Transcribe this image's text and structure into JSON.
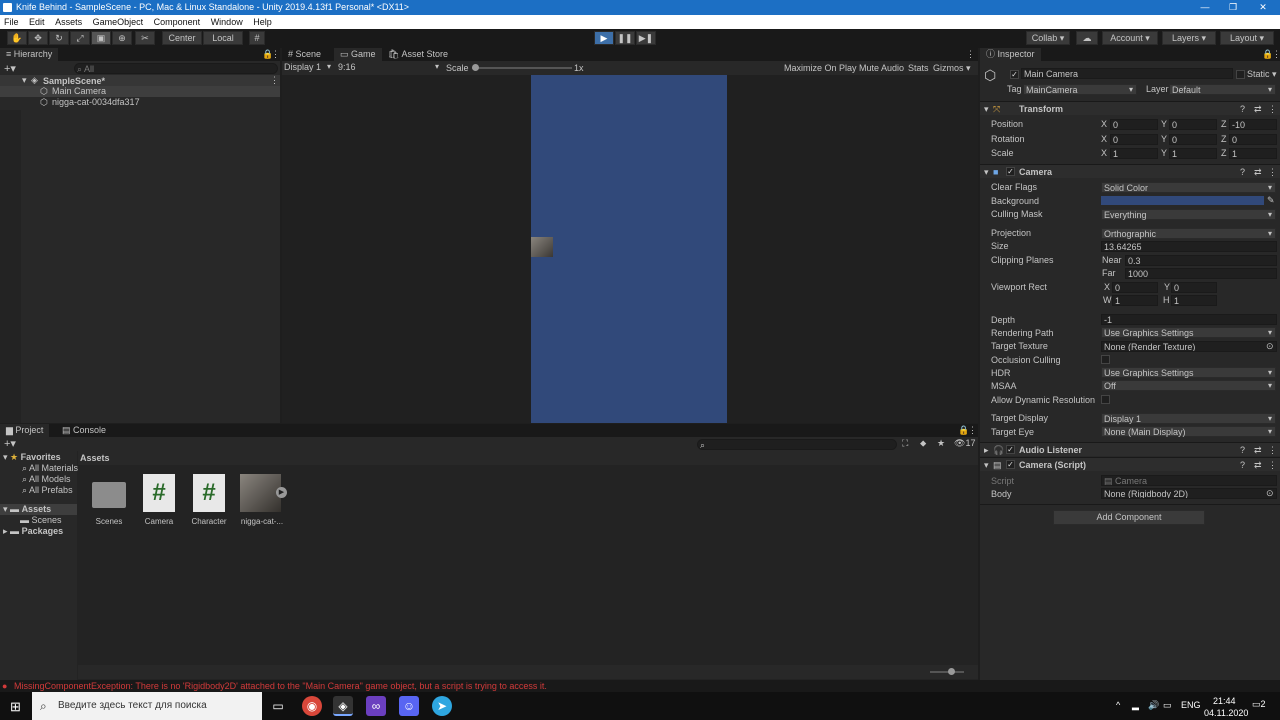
{
  "window": {
    "title": "Knife Behind - SampleScene - PC, Mac & Linux Standalone - Unity 2019.4.13f1 Personal* <DX11>"
  },
  "menu": [
    "File",
    "Edit",
    "Assets",
    "GameObject",
    "Component",
    "Window",
    "Help"
  ],
  "toolbar": {
    "center": "Center",
    "local": "Local",
    "collab": "Collab ▾",
    "account": "Account",
    "layers": "Layers",
    "layout": "Layout"
  },
  "hierarchy": {
    "tab": "Hierarchy",
    "search_placeholder": "All",
    "scene": "SampleScene*",
    "items": [
      "Main Camera",
      "nigga-cat-0034dfa317"
    ]
  },
  "scene_tabs": [
    "Scene",
    "Game",
    "Asset Store"
  ],
  "game": {
    "display": "Display 1",
    "aspect": "9:16",
    "scale_label": "Scale",
    "scale_value": "1x",
    "maximize": "Maximize On Play",
    "mute": "Mute Audio",
    "stats": "Stats",
    "gizmos": "Gizmos",
    "bg_color": "#31497a"
  },
  "project": {
    "tab": "Project",
    "console_tab": "Console",
    "hidden_count": "17",
    "favorites": "Favorites",
    "fav_items": [
      "All Materials",
      "All Models",
      "All Prefabs"
    ],
    "assets_root": "Assets",
    "assets_children": [
      "Scenes"
    ],
    "packages": "Packages",
    "breadcrumb": "Assets",
    "items": [
      {
        "name": "Scenes",
        "icon": "folder-icon"
      },
      {
        "name": "Camera",
        "icon": "csharp-script-icon"
      },
      {
        "name": "Character",
        "icon": "csharp-script-icon"
      },
      {
        "name": "nigga-cat-...",
        "icon": "image-thumbnail-icon"
      }
    ]
  },
  "inspector": {
    "tab": "Inspector",
    "object_name": "Main Camera",
    "static": "Static",
    "tag_label": "Tag",
    "tag": "MainCamera",
    "layer_label": "Layer",
    "layer": "Default",
    "transform": {
      "title": "Transform",
      "position": "Position",
      "rotation": "Rotation",
      "scale": "Scale",
      "pos": [
        "0",
        "0",
        "-10"
      ],
      "rot": [
        "0",
        "0",
        "0"
      ],
      "scl": [
        "1",
        "1",
        "1"
      ]
    },
    "camera": {
      "title": "Camera",
      "clear_flags_label": "Clear Flags",
      "clear_flags": "Solid Color",
      "background_label": "Background",
      "background_color": "#31497a",
      "culling_label": "Culling Mask",
      "culling": "Everything",
      "projection_label": "Projection",
      "projection": "Orthographic",
      "size_label": "Size",
      "size": "13.64265",
      "clipping_label": "Clipping Planes",
      "near_label": "Near",
      "near": "0.3",
      "far_label": "Far",
      "far": "1000",
      "viewport_label": "Viewport Rect",
      "vx": "0",
      "vy": "0",
      "vw": "1",
      "vh": "1",
      "depth_label": "Depth",
      "depth": "-1",
      "render_path_label": "Rendering Path",
      "render_path": "Use Graphics Settings",
      "target_tex_label": "Target Texture",
      "target_tex": "None (Render Texture)",
      "occlusion_label": "Occlusion Culling",
      "hdr_label": "HDR",
      "hdr": "Use Graphics Settings",
      "msaa_label": "MSAA",
      "msaa": "Off",
      "dyn_res_label": "Allow Dynamic Resolution",
      "target_display_label": "Target Display",
      "target_display": "Display 1",
      "target_eye_label": "Target Eye",
      "target_eye": "None (Main Display)"
    },
    "audio_listener": "Audio Listener",
    "camera_script": {
      "title": "Camera (Script)",
      "script_label": "Script",
      "script": "Camera",
      "body_label": "Body",
      "body": "None (Rigidbody 2D)"
    },
    "add_component": "Add Component"
  },
  "status": {
    "error": "MissingComponentException: There is no 'Rigidbody2D' attached to the \"Main Camera\" game object, but a script is trying to access it.",
    "error_color": "#d23a3a"
  },
  "taskbar": {
    "search_placeholder": "Введите здесь текст для поиска",
    "lang": "ENG",
    "time": "21:44",
    "date": "04.11.2020",
    "notifications": "2"
  }
}
